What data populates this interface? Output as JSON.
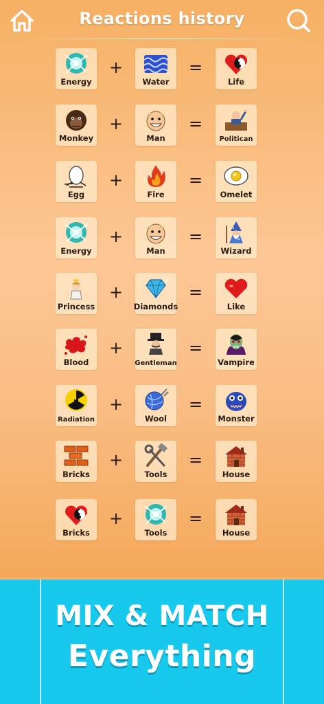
{
  "header": {
    "title": "Reactions history",
    "home_icon": "home-icon",
    "search_icon": "search-icon"
  },
  "operators": {
    "plus": "+",
    "equals": "="
  },
  "reactions": [
    {
      "a": {
        "label": "Energy",
        "icon": "energy-icon"
      },
      "b": {
        "label": "Water",
        "icon": "water-icon"
      },
      "result": {
        "label": "Life",
        "icon": "life-icon"
      }
    },
    {
      "a": {
        "label": "Monkey",
        "icon": "monkey-icon"
      },
      "b": {
        "label": "Man",
        "icon": "man-icon"
      },
      "result": {
        "label": "Politican",
        "icon": "politician-icon"
      }
    },
    {
      "a": {
        "label": "Egg",
        "icon": "egg-icon"
      },
      "b": {
        "label": "Fire",
        "icon": "fire-icon"
      },
      "result": {
        "label": "Omelet",
        "icon": "omelet-icon"
      }
    },
    {
      "a": {
        "label": "Energy",
        "icon": "energy-icon"
      },
      "b": {
        "label": "Man",
        "icon": "man-icon"
      },
      "result": {
        "label": "Wizard",
        "icon": "wizard-icon"
      }
    },
    {
      "a": {
        "label": "Princess",
        "icon": "princess-icon"
      },
      "b": {
        "label": "Diamonds",
        "icon": "diamond-icon"
      },
      "result": {
        "label": "Like",
        "icon": "heart-icon"
      }
    },
    {
      "a": {
        "label": "Blood",
        "icon": "blood-icon"
      },
      "b": {
        "label": "Gentleman",
        "icon": "gentleman-icon"
      },
      "result": {
        "label": "Vampire",
        "icon": "vampire-icon"
      }
    },
    {
      "a": {
        "label": "Radiation",
        "icon": "radiation-icon"
      },
      "b": {
        "label": "Wool",
        "icon": "wool-icon"
      },
      "result": {
        "label": "Monster",
        "icon": "monster-icon"
      }
    },
    {
      "a": {
        "label": "Bricks",
        "icon": "bricks-icon"
      },
      "b": {
        "label": "Tools",
        "icon": "tools-icon"
      },
      "result": {
        "label": "House",
        "icon": "house-icon"
      }
    },
    {
      "a": {
        "label": "Bricks",
        "icon": "life-icon"
      },
      "b": {
        "label": "Tools",
        "icon": "energy-icon"
      },
      "result": {
        "label": "House",
        "icon": "house-icon"
      }
    }
  ],
  "promo": {
    "line1": "MIX & MATCH",
    "line2": "Everything"
  },
  "colors": {
    "background_top": "#f6b063",
    "background_mid": "#fcc795",
    "promo_bg": "#17c9ec",
    "text": "#2a1c10",
    "title": "#ffffff"
  }
}
